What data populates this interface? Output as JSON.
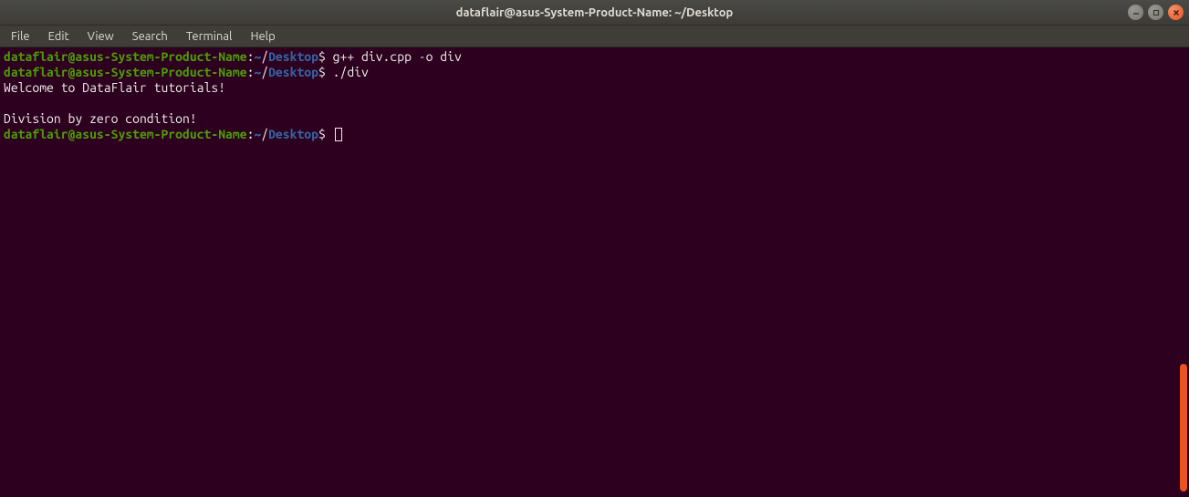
{
  "window": {
    "title": "dataflair@asus-System-Product-Name: ~/Desktop"
  },
  "menubar": {
    "items": [
      "File",
      "Edit",
      "View",
      "Search",
      "Terminal",
      "Help"
    ]
  },
  "prompt": {
    "user_host": "dataflair@asus-System-Product-Name",
    "colon": ":",
    "tilde": "~",
    "slash": "/",
    "dir": "Desktop",
    "symbol": "$"
  },
  "lines": {
    "cmd1": " g++ div.cpp -o div",
    "cmd2": " ./div",
    "out1": "Welcome to DataFlair tutorials!",
    "blank": "",
    "out2": "Division by zero condition!"
  }
}
